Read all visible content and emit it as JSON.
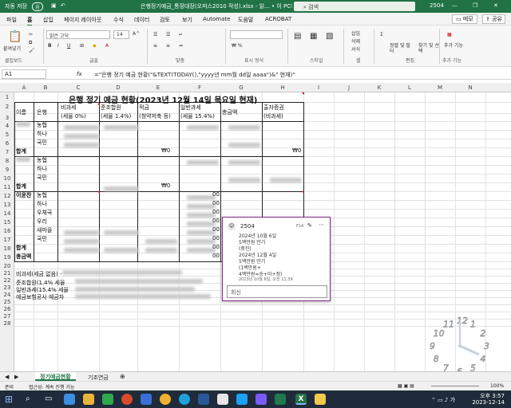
{
  "titlebar": {
    "autosave": "자동 저장",
    "autosave_state": "끔",
    "file": "은행정기예금_통장대장(오피스2010 작성).xlsx - 읽... • 이 PC에 저장됨",
    "search": "검색",
    "user": "2504"
  },
  "menu": [
    "파일",
    "홈",
    "삽입",
    "페이지 레이아웃",
    "수식",
    "데이터",
    "검토",
    "보기",
    "Automate",
    "도움말",
    "ACROBAT"
  ],
  "menu_right": {
    "memo": "메모",
    "share": "공유"
  },
  "ribbon": {
    "paste": "붙여넣기",
    "clipboard": "클립보드",
    "font_name": "맑은 고딕",
    "font_size": "14",
    "font_group": "글꼴",
    "align_group": "맞춤",
    "number_group": "표시 형식",
    "style_group": "스타일",
    "cell_group": "셀",
    "cell_buttons": [
      "삽입",
      "삭제",
      "서식"
    ],
    "edit_group": "편집",
    "sort": "정렬 및 필터",
    "find": "찾기 및 선택",
    "addin_group": "추가 기능",
    "addin": "추가 기능"
  },
  "formula_bar": {
    "namebox": "A1",
    "fx": "fx",
    "formula": "=\"은행 정기 예금 현황(\"&TEXT(TODAY(),\"yyyy년 mm월 dd일 aaaa\")&\" 현재)\""
  },
  "columns": [
    "A",
    "B",
    "C",
    "D",
    "E",
    "F",
    "G",
    "H",
    "I",
    "J",
    "K",
    "L",
    "M",
    "N"
  ],
  "rows": [
    "1",
    "2",
    "3",
    "4",
    "5",
    "6",
    "7",
    "8",
    "9",
    "10",
    "11",
    "12",
    "13",
    "14",
    "15",
    "16",
    "17",
    "18",
    "19",
    "20",
    "21",
    "22",
    "23",
    "24",
    "25",
    "26",
    "27",
    "28"
  ],
  "sheet": {
    "title": "은행 정기 예금 현황(2023년 12월 14일 목요일 현재)",
    "headers": {
      "name": "이름",
      "bank": "은행",
      "tax_free1": "비과세",
      "tax_free2": "(세율 0%)",
      "low_tax1": "준조합원",
      "low_tax2": "(세율 1.4%)",
      "saving1": "적금",
      "saving2": "(청약저축 등)",
      "general1": "일반과세",
      "general2": "(세율 15.4%)",
      "total": "총금액",
      "invest1": "출자증권",
      "invest2": "(비과세)"
    },
    "banks1": [
      "농협",
      "하나",
      "국민"
    ],
    "banks3": [
      "농협",
      "하나",
      "우체국",
      "우리",
      "새마을",
      "국민"
    ],
    "sum_label": "합계",
    "grand_label": "총금액",
    "person3": "이윤찬",
    "zero": "₩0",
    "tail_00": "00",
    "notes": [
      "비과세(세금 없음) -",
      "준조합원(1.4% 세율",
      "일반과세(15.4% 세율",
      "예금보험공사 예금자"
    ]
  },
  "comment": {
    "author": "2504",
    "tag": "F14",
    "lines": [
      "2024년 10월 6일",
      "5백만원 만기",
      "(중진)",
      "2024년 12월 4일",
      "5백만원 만기",
      "(1백만원+",
      "4백만원=송+아+정)"
    ],
    "date": "2023년 10월 6일, 오전 11:39",
    "reply": "회신"
  },
  "clock": {
    "numbers": [
      "12",
      "1",
      "2",
      "3",
      "4",
      "5",
      "6",
      "7",
      "8",
      "9",
      "10",
      "11"
    ]
  },
  "tabs": [
    "기본정보",
    "정기예금현황",
    "기조연금"
  ],
  "status": {
    "ready": "준비",
    "accessibility": "접근성: 계속 진행 가능",
    "zoom": "100%"
  },
  "taskbar": {
    "time": "오후 3:57",
    "date": "2023-12-14"
  },
  "colors": {
    "excel_green": "#217346",
    "comment_border": "#8a2a8a",
    "clock": "#c8d0d8"
  }
}
